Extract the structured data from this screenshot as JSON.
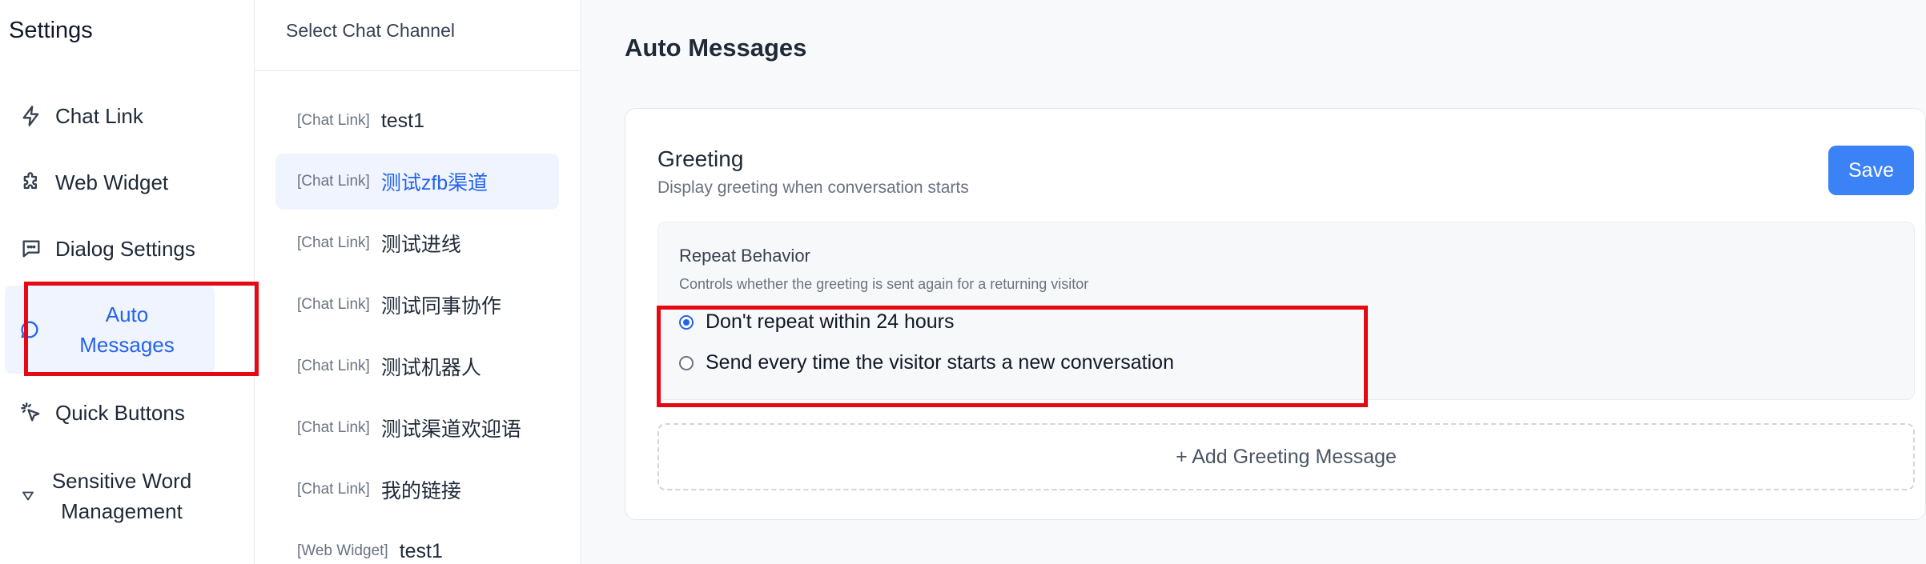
{
  "sidebar": {
    "title": "Settings",
    "items": [
      {
        "label": "Chat Link",
        "icon": "lightning-icon"
      },
      {
        "label": "Web Widget",
        "icon": "puzzle-icon"
      },
      {
        "label": "Dialog Settings",
        "icon": "message-square-icon"
      },
      {
        "label": "Auto\nMessages",
        "icon": "message-circle-icon",
        "active": true
      },
      {
        "label": "Quick Buttons",
        "icon": "pointer-click-icon"
      },
      {
        "label": "Sensitive Word\nManagement",
        "icon": "filter-icon"
      }
    ]
  },
  "channels": {
    "header": "Select Chat Channel",
    "items": [
      {
        "tag": "[Chat Link]",
        "name": "test1"
      },
      {
        "tag": "[Chat Link]",
        "name": "测试zfb渠道",
        "selected": true
      },
      {
        "tag": "[Chat Link]",
        "name": "测试进线"
      },
      {
        "tag": "[Chat Link]",
        "name": "测试同事协作"
      },
      {
        "tag": "[Chat Link]",
        "name": "测试机器人"
      },
      {
        "tag": "[Chat Link]",
        "name": "测试渠道欢迎语"
      },
      {
        "tag": "[Chat Link]",
        "name": "我的链接"
      },
      {
        "tag": "[Web Widget]",
        "name": "test1"
      }
    ]
  },
  "main": {
    "title": "Auto Messages",
    "greeting": {
      "title": "Greeting",
      "subtitle": "Display greeting when conversation starts",
      "save_label": "Save",
      "repeat": {
        "title": "Repeat Behavior",
        "description": "Controls whether the greeting is sent again for a returning visitor",
        "options": [
          {
            "label": "Don't repeat within 24 hours",
            "checked": true
          },
          {
            "label": "Send every time the visitor starts a new conversation",
            "checked": false
          }
        ]
      },
      "add_label": "+ Add Greeting Message"
    }
  },
  "colors": {
    "accent": "#3b82f6",
    "active_text": "#2563eb",
    "active_bg": "#eff4ff",
    "annotation": "#e50914"
  }
}
